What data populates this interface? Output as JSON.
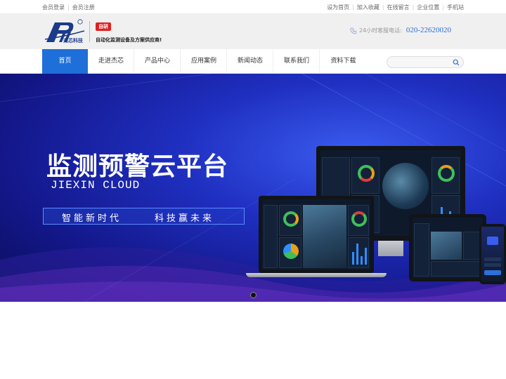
{
  "topbar": {
    "left": [
      "会员登录",
      "会员注册"
    ],
    "right": [
      "设为首页",
      "加入收藏",
      "在线留言",
      "企业位置",
      "手机站"
    ]
  },
  "header": {
    "logo_text": "杰芯科技",
    "badge": "自研",
    "slogan": "自动化监测设备及方案供应商!",
    "hotline_label": "24小时客服电话:",
    "hotline_number": "020-22620020"
  },
  "nav": {
    "items": [
      "首页",
      "走进杰芯",
      "产品中心",
      "应用案例",
      "新闻动态",
      "联系我们",
      "资料下载"
    ],
    "active_index": 0
  },
  "search": {
    "placeholder": "",
    "value": ""
  },
  "banner": {
    "title": "监测预警云平台",
    "subtitle": "JIEXIN CLOUD",
    "tag1": "智能新时代",
    "tag2": "科技赢未来"
  },
  "colors": {
    "accent": "#1e6fd9",
    "badge": "#e02020",
    "phone": "#2a6fd6",
    "banner_dark": "#0b0d55",
    "banner_light": "#3a5cf0"
  },
  "icons": {
    "phone": "phone-icon",
    "search": "search-icon",
    "logo": "logo-icon"
  }
}
